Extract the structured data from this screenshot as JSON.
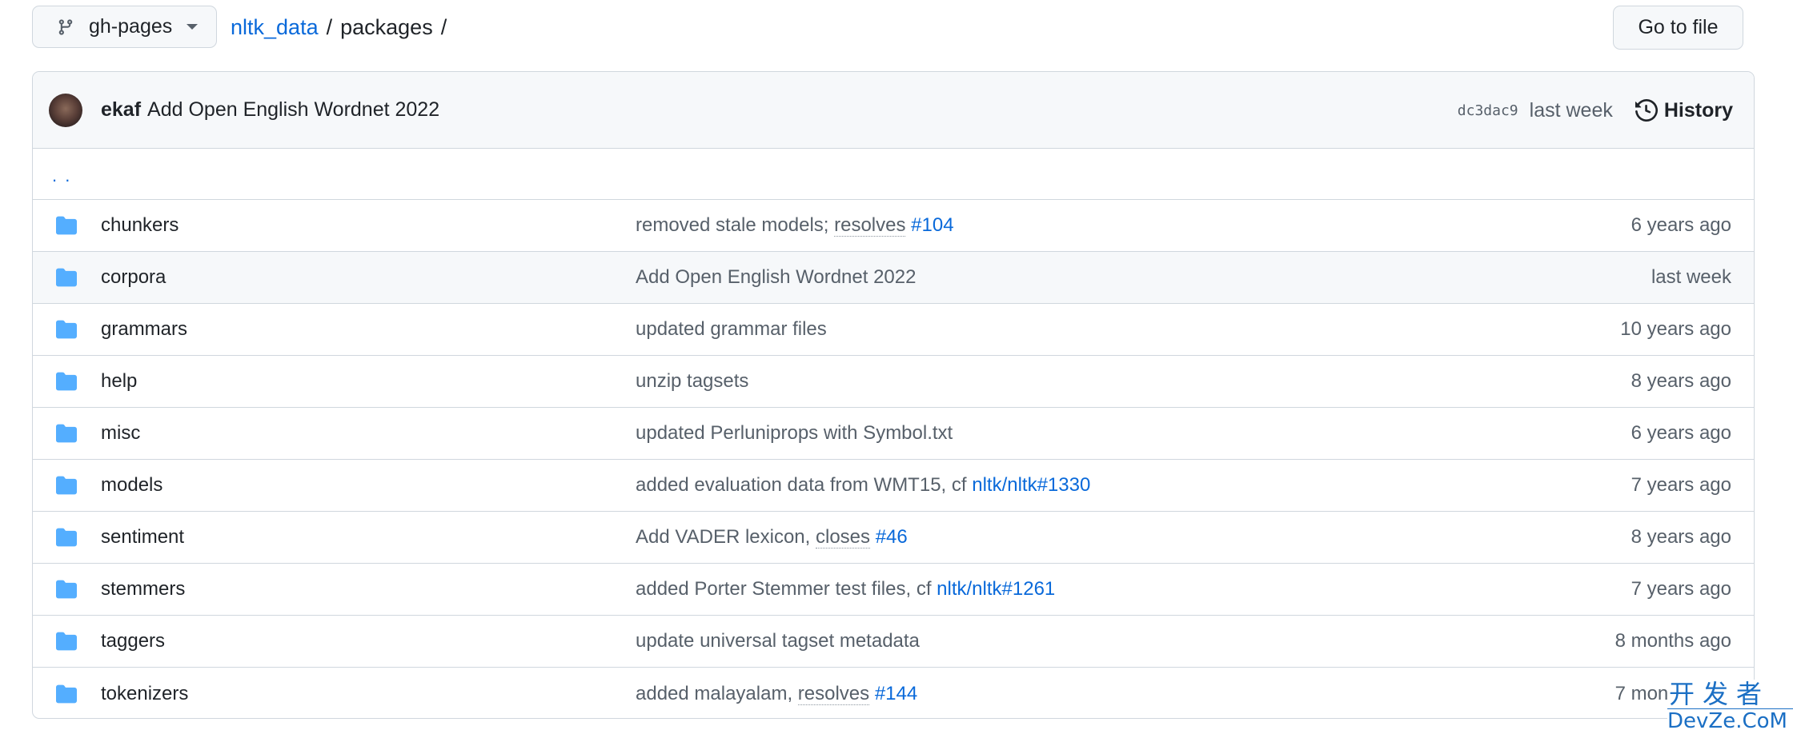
{
  "branch": {
    "label": "gh-pages",
    "icon": "git-branch-icon"
  },
  "breadcrumb": {
    "repo": "nltk_data",
    "separator": "/",
    "current": "packages",
    "trailing": "/"
  },
  "goto_file": {
    "label": "Go to file"
  },
  "latest_commit": {
    "author": "ekaf",
    "message": "Add Open English Wordnet 2022",
    "sha": "dc3dac9",
    "date": "last week",
    "history_label": "History"
  },
  "parent_dir": {
    "label": ". ."
  },
  "files": [
    {
      "name": "chunkers",
      "type": "folder",
      "message_parts": [
        {
          "text": "removed stale models; ",
          "kind": "plain"
        },
        {
          "text": "resolves",
          "kind": "dotted"
        },
        {
          "text": " ",
          "kind": "plain"
        },
        {
          "text": "#104",
          "kind": "issue"
        }
      ],
      "date": "6 years ago"
    },
    {
      "name": "corpora",
      "type": "folder",
      "message_parts": [
        {
          "text": "Add Open English Wordnet 2022",
          "kind": "plain"
        }
      ],
      "date": "last week",
      "hovered": true
    },
    {
      "name": "grammars",
      "type": "folder",
      "message_parts": [
        {
          "text": "updated grammar files",
          "kind": "plain"
        }
      ],
      "date": "10 years ago"
    },
    {
      "name": "help",
      "type": "folder",
      "message_parts": [
        {
          "text": "unzip tagsets",
          "kind": "plain"
        }
      ],
      "date": "8 years ago"
    },
    {
      "name": "misc",
      "type": "folder",
      "message_parts": [
        {
          "text": "updated Perluniprops with Symbol.txt",
          "kind": "plain"
        }
      ],
      "date": "6 years ago"
    },
    {
      "name": "models",
      "type": "folder",
      "message_parts": [
        {
          "text": "added evaluation data from WMT15, cf ",
          "kind": "plain"
        },
        {
          "text": "nltk/nltk#1330",
          "kind": "issue"
        }
      ],
      "date": "7 years ago"
    },
    {
      "name": "sentiment",
      "type": "folder",
      "message_parts": [
        {
          "text": "Add VADER lexicon, ",
          "kind": "plain"
        },
        {
          "text": "closes",
          "kind": "dotted"
        },
        {
          "text": " ",
          "kind": "plain"
        },
        {
          "text": "#46",
          "kind": "issue"
        }
      ],
      "date": "8 years ago"
    },
    {
      "name": "stemmers",
      "type": "folder",
      "message_parts": [
        {
          "text": "added Porter Stemmer test files, cf ",
          "kind": "plain"
        },
        {
          "text": "nltk/nltk#1261",
          "kind": "issue"
        }
      ],
      "date": "7 years ago"
    },
    {
      "name": "taggers",
      "type": "folder",
      "message_parts": [
        {
          "text": "update universal tagset metadata",
          "kind": "plain"
        }
      ],
      "date": "8 months ago"
    },
    {
      "name": "tokenizers",
      "type": "folder",
      "message_parts": [
        {
          "text": "added malayalam, ",
          "kind": "plain"
        },
        {
          "text": "resolves",
          "kind": "dotted"
        },
        {
          "text": " ",
          "kind": "plain"
        },
        {
          "text": "#144",
          "kind": "issue"
        }
      ],
      "date": "7 months ago"
    }
  ],
  "watermark": {
    "cn": "开发者",
    "en": "DevZe.CoM"
  },
  "colors": {
    "link": "#0969da",
    "folder": "#54aeff",
    "muted": "#57606a",
    "border": "#d0d7de",
    "header_bg": "#f6f8fa"
  }
}
